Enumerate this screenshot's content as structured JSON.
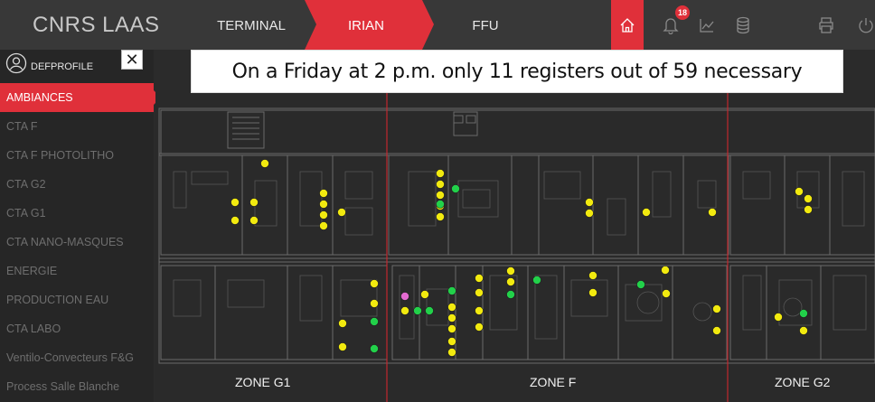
{
  "header": {
    "brand": "CNRS LAAS",
    "tabs": [
      {
        "label": "TERMINAL",
        "active": false
      },
      {
        "label": "IRIAN",
        "active": true
      },
      {
        "label": "FFU",
        "active": false
      }
    ],
    "notification_count": "18",
    "accent_color": "#e0303a",
    "icons": [
      "home-icon",
      "bell-icon",
      "trend-chart-icon",
      "database-icon",
      "printer-icon",
      "power-icon"
    ]
  },
  "sidebar": {
    "profile": {
      "name": "DEFPROFILE",
      "close_symbol": "✕"
    },
    "items": [
      {
        "label": "AMBIANCES",
        "active": true
      },
      {
        "label": "CTA F"
      },
      {
        "label": "CTA F PHOTOLITHO"
      },
      {
        "label": "CTA G2"
      },
      {
        "label": "CTA G1"
      },
      {
        "label": "CTA NANO-MASQUES"
      },
      {
        "label": "ENERGIE"
      },
      {
        "label": "PRODUCTION EAU"
      },
      {
        "label": "CTA LABO"
      },
      {
        "label": "Ventilo-Convecteurs F&G"
      },
      {
        "label": "Process Salle Blanche"
      }
    ]
  },
  "banner": {
    "text": "On a Friday at 2 p.m. only 11 registers out of 59 necessary"
  },
  "plan": {
    "zones": [
      "ZONE G1",
      "ZONE F",
      "ZONE G2"
    ],
    "status_colors": {
      "yellow": "#f2ea0f",
      "green": "#22d14a",
      "pink": "#e36ad0"
    },
    "register_count_shown": 11,
    "register_count_required": 59
  }
}
